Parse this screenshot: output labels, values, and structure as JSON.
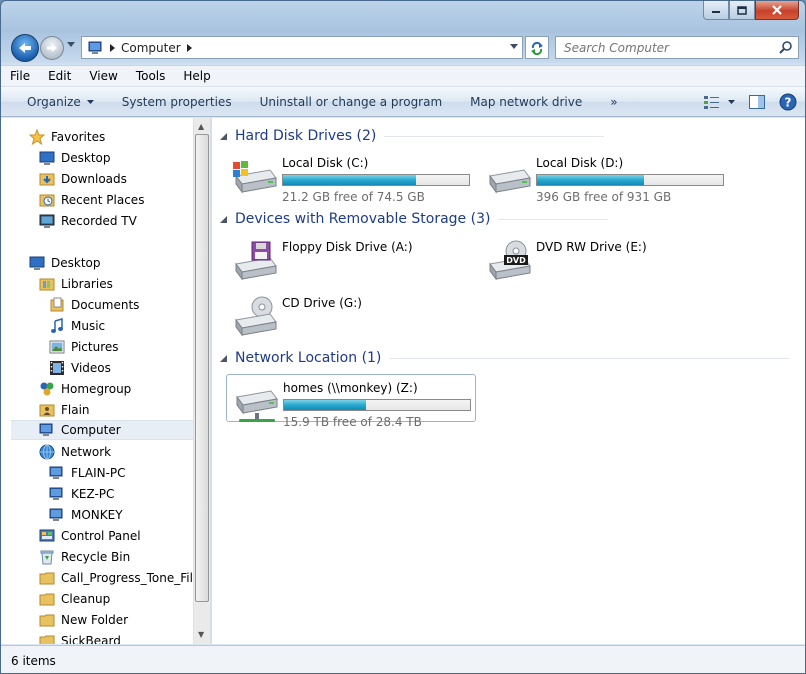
{
  "address": {
    "path": "Computer"
  },
  "search": {
    "placeholder": "Search Computer"
  },
  "menu": [
    "File",
    "Edit",
    "View",
    "Tools",
    "Help"
  ],
  "commands": {
    "organize": "Organize",
    "system_properties": "System properties",
    "uninstall": "Uninstall or change a program",
    "map_drive": "Map network drive",
    "more": "»"
  },
  "nav": {
    "favorites": "Favorites",
    "desktop_fav": "Desktop",
    "downloads": "Downloads",
    "recent": "Recent Places",
    "recorded_tv": "Recorded TV",
    "desktop": "Desktop",
    "libraries": "Libraries",
    "documents": "Documents",
    "music": "Music",
    "pictures": "Pictures",
    "videos": "Videos",
    "homegroup": "Homegroup",
    "flain": "Flain",
    "computer": "Computer",
    "network": "Network",
    "flain_pc": "FLAIN-PC",
    "kez_pc": "KEZ-PC",
    "monkey": "MONKEY",
    "control_panel": "Control Panel",
    "recycle_bin": "Recycle Bin",
    "call_progress": "Call_Progress_Tone_Files",
    "cleanup": "Cleanup",
    "new_folder": "New Folder",
    "sickbeard": "SickBeard"
  },
  "groups": {
    "hdd": "Hard Disk Drives (2)",
    "removable": "Devices with Removable Storage (3)",
    "network": "Network Location (1)"
  },
  "drives": {
    "c": {
      "name": "Local Disk (C:)",
      "free": "21.2 GB free of 74.5 GB",
      "used": 0.715
    },
    "d": {
      "name": "Local Disk (D:)",
      "free": "396 GB free of 931 GB",
      "used": 0.575
    },
    "a": {
      "name": "Floppy Disk Drive (A:)"
    },
    "e": {
      "name": "DVD RW Drive (E:)",
      "badge": "DVD"
    },
    "g": {
      "name": "CD Drive (G:)"
    },
    "z": {
      "name": "homes (\\\\monkey) (Z:)",
      "free": "15.9 TB free of 28.4 TB",
      "used": 0.44
    }
  },
  "status": {
    "items": "6 items"
  },
  "colors": {
    "accent": "#1e3b87",
    "bar_fill": "#27a9cf"
  }
}
